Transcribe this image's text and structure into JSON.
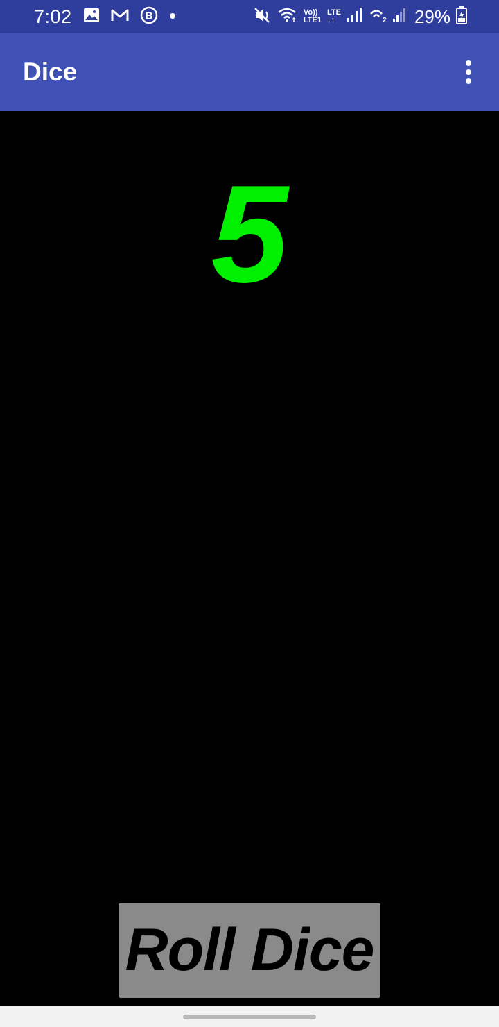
{
  "status_bar": {
    "time": "7:02",
    "left_icons": [
      "image-icon",
      "gmail-icon",
      "b-icon",
      "dot-icon"
    ],
    "right_icons": [
      "mute-icon",
      "wifi-icon",
      "volte-icon",
      "signal-1-icon",
      "wifi-calling-icon",
      "signal-2-icon",
      "battery-charging-icon"
    ],
    "volte_top": "Vo))",
    "volte_bottom": "LTE1",
    "lte_top": "LTE",
    "lte_bottom": "↓↑",
    "battery_percent": "29%"
  },
  "app_bar": {
    "title": "Dice",
    "menu_icon": "more-vert-icon",
    "color": "#3f51b5"
  },
  "main": {
    "dice_value": "5",
    "dice_color": "#00f000",
    "roll_button_label": "Roll Dice",
    "button_color": "#8a8a8a"
  },
  "colors": {
    "status_bar": "#2f3d9c",
    "background": "#000000"
  }
}
